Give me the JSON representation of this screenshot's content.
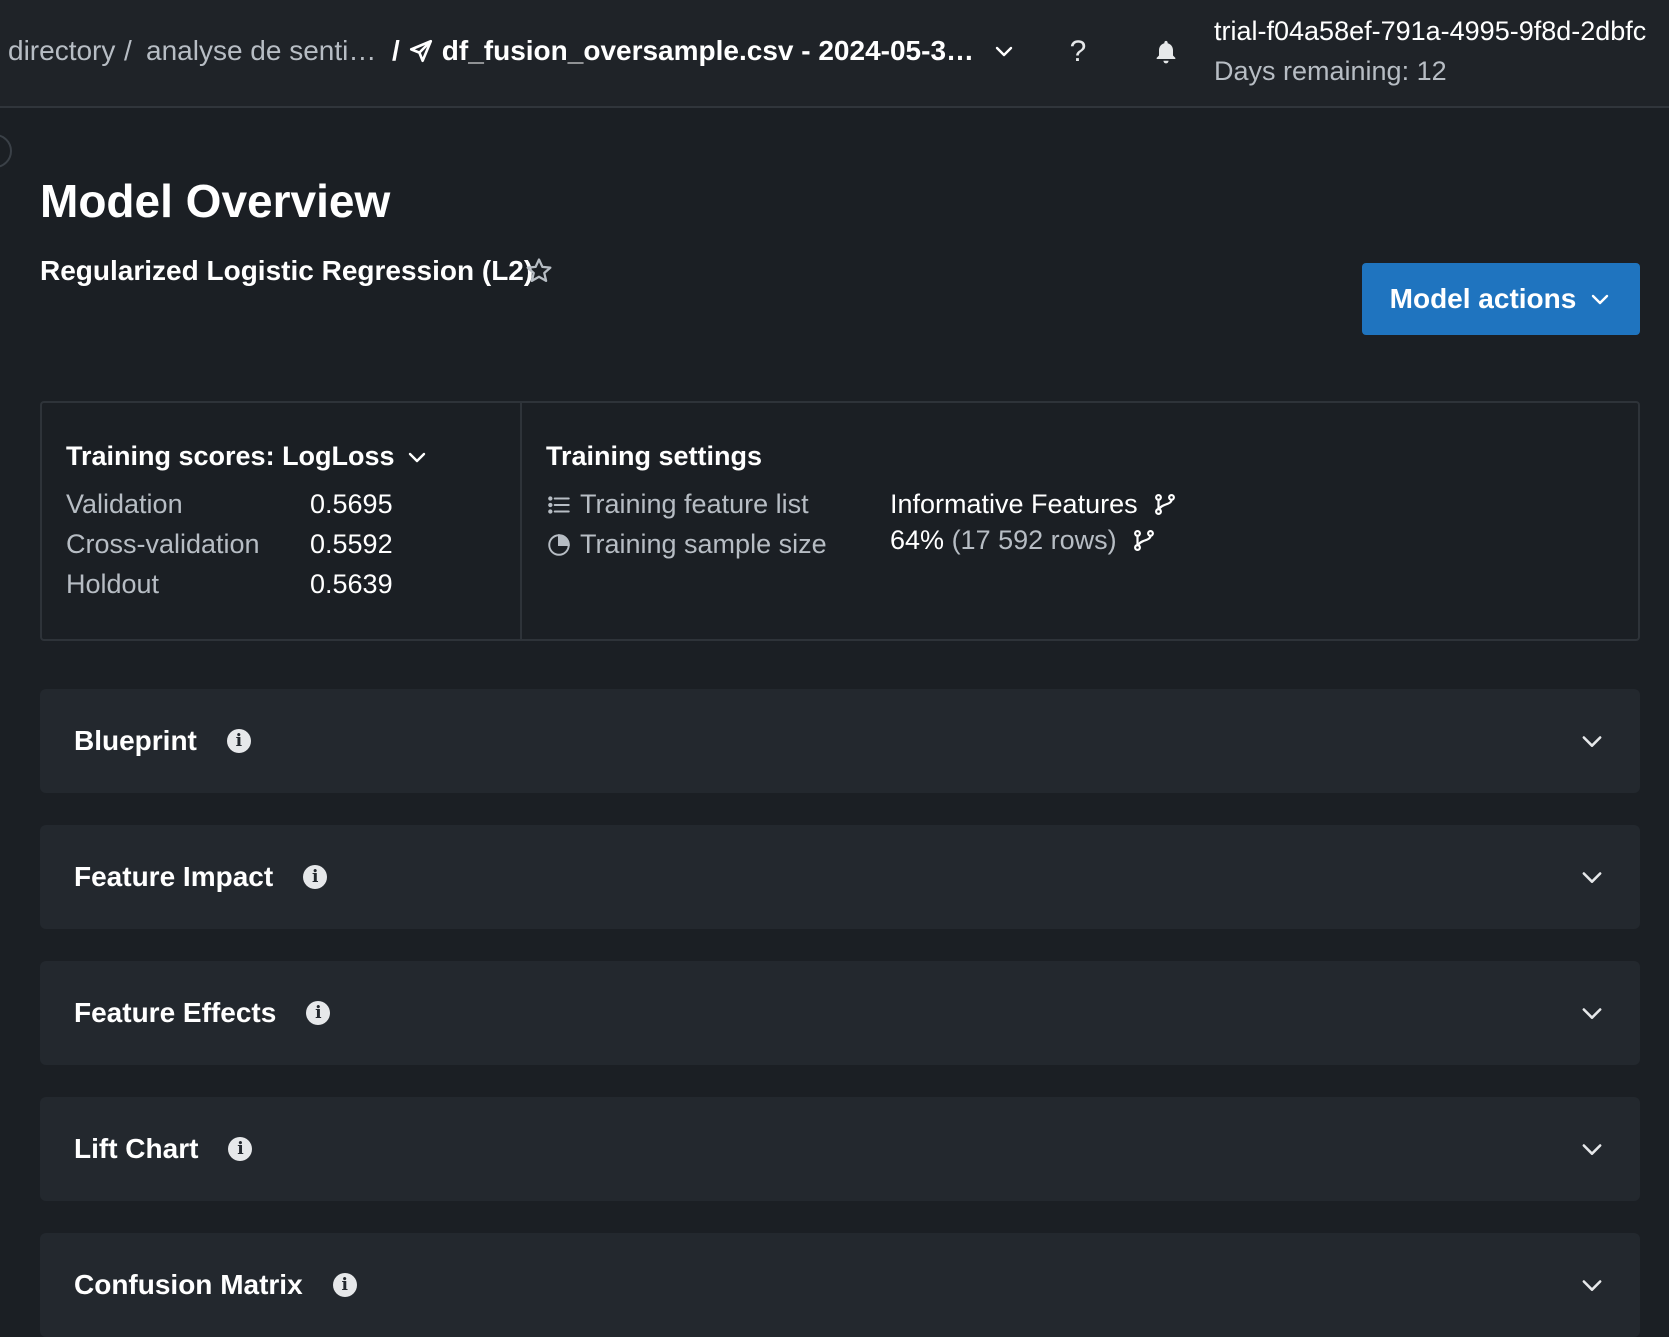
{
  "topbar": {
    "breadcrumb_1": "directory",
    "breadcrumb_sep_1": "/",
    "breadcrumb_2": "analyse de senti…",
    "breadcrumb_sep_2": "/",
    "current_item": "df_fusion_oversample.csv - 2024-05-3…",
    "help_label": "?",
    "trial_id": "trial-f04a58ef-791a-4995-9f8d-2dbfc",
    "days_remaining": "Days remaining: 12"
  },
  "header": {
    "title": "Model Overview",
    "model_name": "Regularized Logistic Regression (L2)",
    "model_actions_label": "Model actions"
  },
  "training_scores": {
    "heading": "Training scores: LogLoss",
    "rows": [
      {
        "label": "Validation",
        "value": "0.5695"
      },
      {
        "label": "Cross-validation",
        "value": "0.5592"
      },
      {
        "label": "Holdout",
        "value": "0.5639"
      }
    ]
  },
  "training_settings": {
    "heading": "Training settings",
    "feature_list_label": "Training feature list",
    "feature_list_value": "Informative Features",
    "sample_size_label": "Training sample size",
    "sample_size_percent": "64%",
    "sample_size_rows": "(17 592 rows)"
  },
  "sections": [
    {
      "title": "Blueprint"
    },
    {
      "title": "Feature Impact"
    },
    {
      "title": "Feature Effects"
    },
    {
      "title": "Lift Chart"
    },
    {
      "title": "Confusion Matrix"
    }
  ],
  "icons": {
    "star": "star-icon",
    "bell": "bell-icon",
    "help": "help-icon",
    "info": "info-icon",
    "chevron": "chevron-down-icon",
    "branch": "branch-icon",
    "list": "list-icon",
    "pie": "pie-icon"
  },
  "colors": {
    "background": "#1b1f24",
    "panel": "#23282e",
    "accent": "#1f74bf",
    "text": "#ffffff",
    "muted": "#b7bdc4"
  }
}
